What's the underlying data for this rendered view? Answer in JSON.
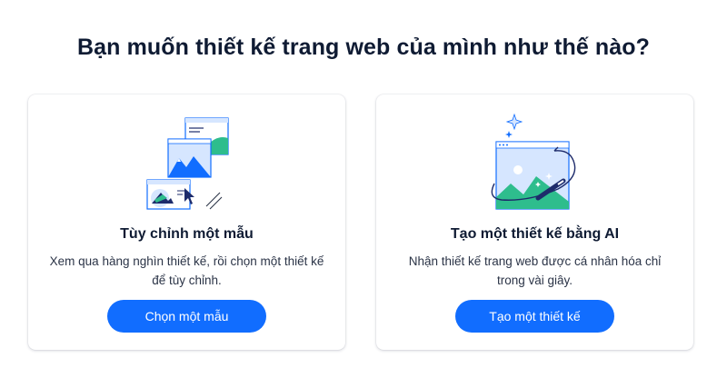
{
  "page": {
    "heading": "Bạn muốn thiết kế trang web của mình như thế nào?"
  },
  "cards": [
    {
      "title": "Tùy chỉnh một mẫu",
      "description": "Xem qua hàng nghìn thiết kế, rồi chọn một thiết kế để tùy chỉnh.",
      "button_label": "Chọn một mẫu",
      "illustration": "stacked-templates-icon"
    },
    {
      "title": "Tạo một thiết kế bằng AI",
      "description": "Nhận thiết kế trang web được cá nhân hóa chỉ trong vài giây.",
      "button_label": "Tạo một thiết kế",
      "illustration": "ai-magic-wand-icon"
    }
  ],
  "colors": {
    "accent": "#116dff",
    "heading": "#0f1b33",
    "illustration_green": "#2ebd8d",
    "illustration_navy": "#1d2b6b",
    "illustration_light": "#d6e6ff"
  }
}
